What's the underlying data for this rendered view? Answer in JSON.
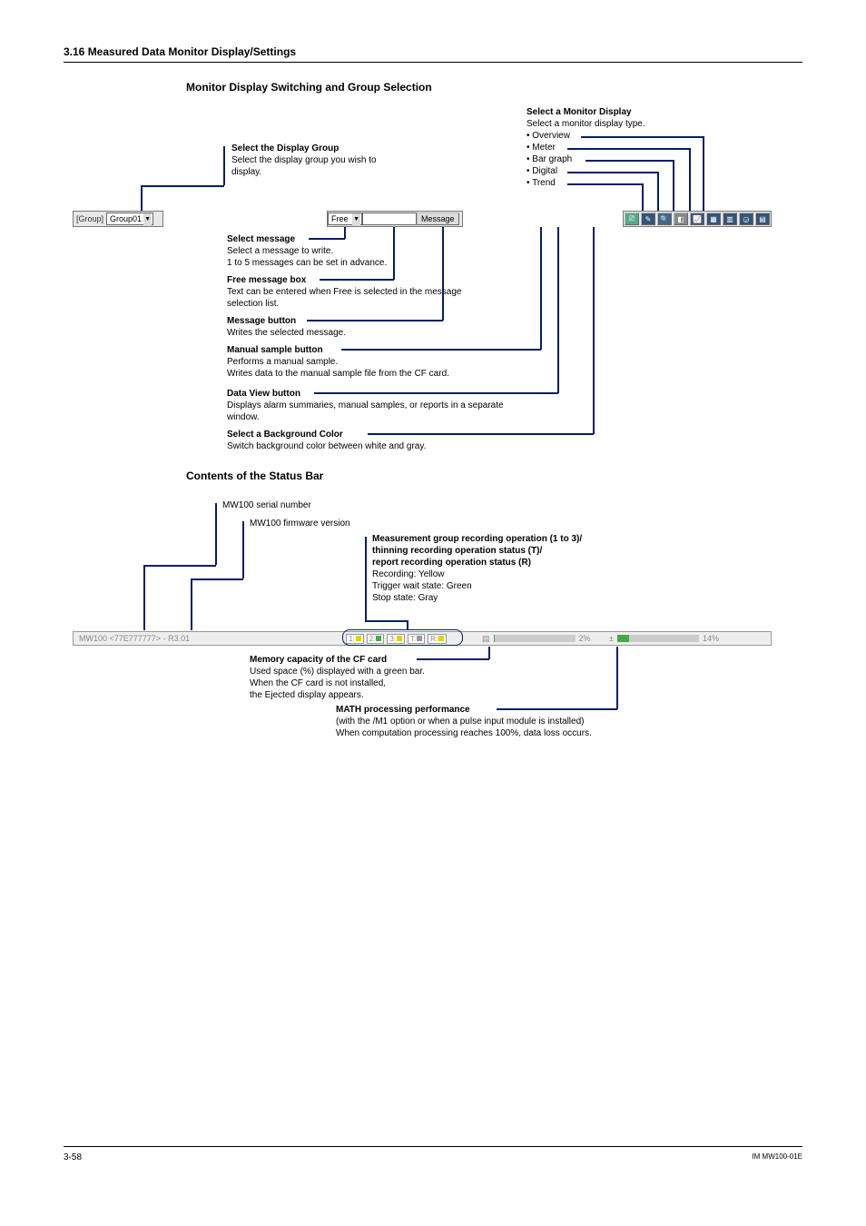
{
  "section_header": "3.16  Measured Data Monitor Display/Settings",
  "h1": "Monitor Display Switching and Group Selection",
  "h2": "Contents of the Status Bar",
  "tb": {
    "group_label": "[Group]",
    "group_value": "Group01",
    "msg_select": "Free",
    "msg_button": "Message"
  },
  "d": {
    "monitor_title": "Select a Monitor Display",
    "monitor_sub": "Select a monitor display type.",
    "monitor_items": [
      "• Overview",
      "• Meter",
      "• Bar graph",
      "• Digital",
      "• Trend"
    ],
    "group_title": "Select the Display Group",
    "group_sub": "Select the display group you wish to display.",
    "selmsg_t": "Select message",
    "selmsg_s": "Select a message to write.\n1 to 5 messages can be set in advance.",
    "freemsg_t": "Free message box",
    "freemsg_s": "Text can be entered when Free is selected in the message selection list.",
    "msgbtn_t": "Message button",
    "msgbtn_s": "Writes the selected message.",
    "manual_t": "Manual sample button",
    "manual_s": "Performs a manual sample.\nWrites data to the manual sample file from the CF card.",
    "dataview_t": "Data View button",
    "dataview_s": "Displays alarm summaries, manual samples, or reports in a separate window.",
    "bg_t": "Select a Background Color",
    "bg_s": "Switch background color between white and gray."
  },
  "sb": {
    "serial_t": "MW100 serial number",
    "fw_t": "MW100 firmware version",
    "rec_t": "Measurement group recording operation (1 to 3)/\nthinning recording operation status (T)/\nreport recording operation status (R)",
    "rec_s": "Recording: Yellow\nTrigger wait state: Green\nStop state: Gray",
    "sb_id": "MW100 <77E777777> - R3.01",
    "segs": [
      "1:",
      "2:",
      "3:",
      "T:",
      "R:"
    ],
    "card_pct": "2%",
    "math_pct": "14%",
    "cf_t": "Memory capacity of the CF card",
    "cf_s": "Used space (%) displayed with a green bar.\nWhen the CF card is not installed,\nthe Ejected display appears.",
    "math_t": "MATH processing performance",
    "math_s": "(with the /M1 option or when a pulse input module is installed)\nWhen computation processing reaches 100%, data loss occurs."
  },
  "footer": {
    "page": "3-58",
    "doc": "IM MW100-01E"
  }
}
